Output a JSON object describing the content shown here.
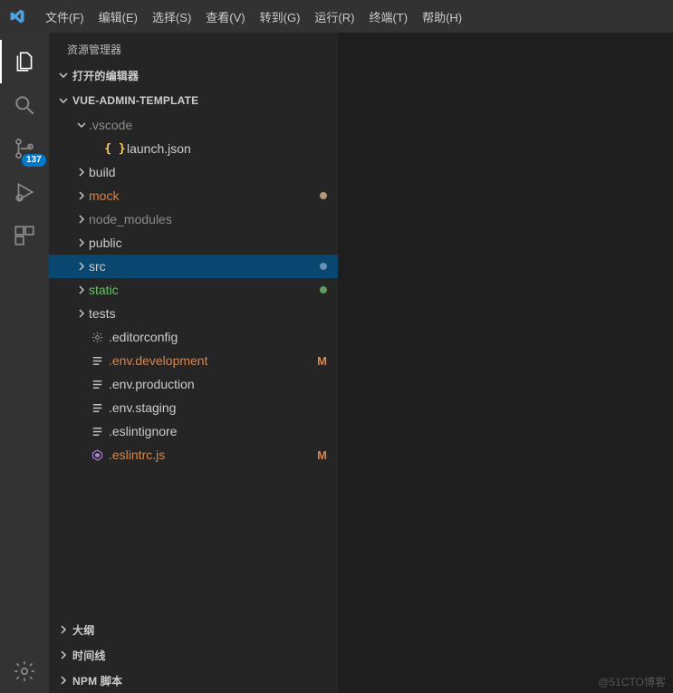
{
  "menu": {
    "items": [
      "文件(F)",
      "编辑(E)",
      "选择(S)",
      "查看(V)",
      "转到(G)",
      "运行(R)",
      "终端(T)",
      "帮助(H)"
    ]
  },
  "activity": {
    "scm_badge": "137"
  },
  "sidebar": {
    "title": "资源管理器",
    "sections": {
      "openEditors": "打开的编辑器",
      "project": "VUE-ADMIN-TEMPLATE",
      "outline": "大纲",
      "timeline": "时间线",
      "npm": "NPM 脚本"
    },
    "tree": [
      {
        "name": ".vscode",
        "kind": "folder",
        "expanded": true,
        "depth": 1,
        "color": "c-muted"
      },
      {
        "name": "launch.json",
        "kind": "file",
        "icon": "braces",
        "depth": 2,
        "color": "c-default"
      },
      {
        "name": "build",
        "kind": "folder",
        "expanded": false,
        "depth": 1,
        "color": "c-default"
      },
      {
        "name": "mock",
        "kind": "folder",
        "expanded": false,
        "depth": 1,
        "color": "c-orange",
        "dot": "dot-tan"
      },
      {
        "name": "node_modules",
        "kind": "folder",
        "expanded": false,
        "depth": 1,
        "color": "c-muted"
      },
      {
        "name": "public",
        "kind": "folder",
        "expanded": false,
        "depth": 1,
        "color": "c-default"
      },
      {
        "name": "src",
        "kind": "folder",
        "expanded": false,
        "depth": 1,
        "color": "c-default",
        "dot": "dot-blue",
        "selected": true
      },
      {
        "name": "static",
        "kind": "folder",
        "expanded": false,
        "depth": 1,
        "color": "c-green",
        "dot": "dot-green"
      },
      {
        "name": "tests",
        "kind": "folder",
        "expanded": false,
        "depth": 1,
        "color": "c-default"
      },
      {
        "name": ".editorconfig",
        "kind": "file",
        "icon": "gear",
        "depth": 1,
        "color": "c-default"
      },
      {
        "name": ".env.development",
        "kind": "file",
        "icon": "lines",
        "depth": 1,
        "color": "c-orange",
        "mark": "M"
      },
      {
        "name": ".env.production",
        "kind": "file",
        "icon": "lines",
        "depth": 1,
        "color": "c-default"
      },
      {
        "name": ".env.staging",
        "kind": "file",
        "icon": "lines",
        "depth": 1,
        "color": "c-default"
      },
      {
        "name": ".eslintignore",
        "kind": "file",
        "icon": "lines",
        "depth": 1,
        "color": "c-default"
      },
      {
        "name": ".eslintrc.js",
        "kind": "file",
        "icon": "eslint",
        "depth": 1,
        "color": "c-orange",
        "mark": "M"
      }
    ]
  },
  "watermark": "@51CTO博客"
}
